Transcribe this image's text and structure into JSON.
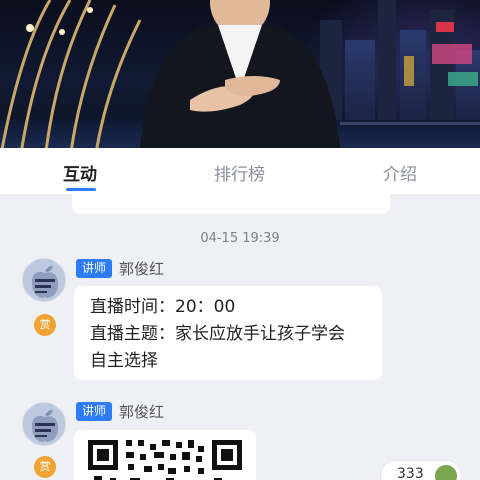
{
  "tabs": [
    {
      "label": "互动",
      "active": true
    },
    {
      "label": "排行榜",
      "active": false
    },
    {
      "label": "介绍",
      "active": false
    }
  ],
  "chat": {
    "previous_fragment": "' '",
    "timestamp": "04-15 19:39",
    "messages": [
      {
        "role_badge": "讲师",
        "sender": "郭俊红",
        "reward_label": "赏",
        "lines": [
          "直播时间：20：00",
          "直播主题：家长应放手让孩子学会",
          "自主选择"
        ]
      },
      {
        "role_badge": "讲师",
        "sender": "郭俊红",
        "reward_label": "赏",
        "content_type": "qr-code-image"
      }
    ]
  },
  "online_count": "333",
  "colors": {
    "accent": "#2d7cf6",
    "reward": "#f0a232",
    "background": "#eef0f5"
  }
}
